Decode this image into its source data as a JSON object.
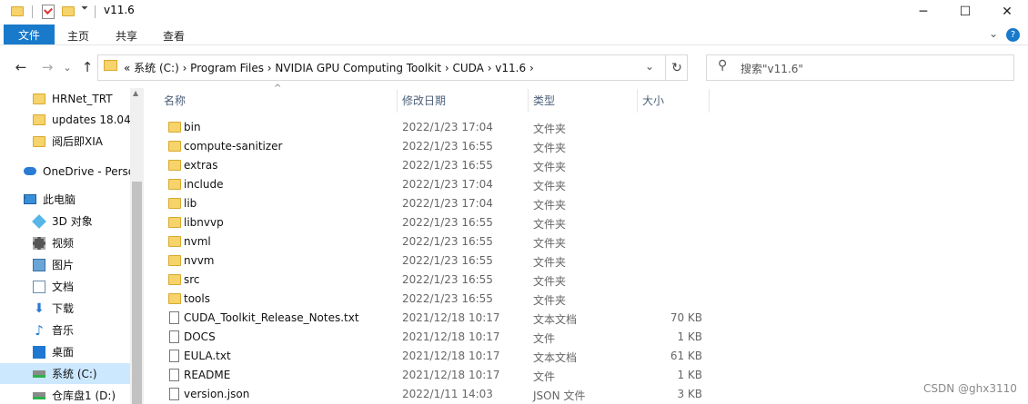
{
  "window": {
    "title": "v11.6",
    "controls": {
      "minimize": "─",
      "maximize": "☐",
      "close": "✕"
    }
  },
  "ribbon": {
    "tabs": [
      "文件",
      "主页",
      "共享",
      "查看"
    ],
    "expand_icon": "⌄",
    "help_icon": "?"
  },
  "navigation": {
    "back": "←",
    "forward": "→",
    "recent": "⌄",
    "up": "↑"
  },
  "address_bar": {
    "text": "«  系统 (C:)  ›  Program Files  ›  NVIDIA GPU Computing Toolkit  ›  CUDA  ›  v11.6  ›",
    "dropdown_icon": "⌄",
    "refresh_icon": "↻"
  },
  "search": {
    "placeholder": "搜索\"v11.6\"",
    "icon": "⚲"
  },
  "nav_pane": {
    "items": [
      {
        "label": "HRNet_TRT",
        "icon": "folder-icon"
      },
      {
        "label": "updates 18.04.",
        "icon": "folder-icon"
      },
      {
        "label": "阅后即XIA",
        "icon": "folder-icon"
      },
      {
        "label": "OneDrive - Perso",
        "icon": "cloud-icon"
      },
      {
        "label": "此电脑",
        "icon": "computer-icon"
      },
      {
        "label": "3D 对象",
        "icon": "cube-icon"
      },
      {
        "label": "视频",
        "icon": "video-icon"
      },
      {
        "label": "图片",
        "icon": "picture-icon"
      },
      {
        "label": "文档",
        "icon": "document-icon"
      },
      {
        "label": "下载",
        "icon": "download-icon"
      },
      {
        "label": "音乐",
        "icon": "music-icon"
      },
      {
        "label": "桌面",
        "icon": "desktop-icon"
      },
      {
        "label": "系统 (C:)",
        "icon": "drive-icon",
        "selected": true
      },
      {
        "label": "仓库盘1 (D:)",
        "icon": "drive-icon"
      }
    ]
  },
  "file_list": {
    "columns": {
      "name": "名称",
      "date": "修改日期",
      "type": "类型",
      "size": "大小"
    },
    "sort_indicator": "^",
    "rows": [
      {
        "name": "bin",
        "date": "2022/1/23 17:04",
        "type": "文件夹",
        "size": "",
        "kind": "folder"
      },
      {
        "name": "compute-sanitizer",
        "date": "2022/1/23 16:55",
        "type": "文件夹",
        "size": "",
        "kind": "folder"
      },
      {
        "name": "extras",
        "date": "2022/1/23 16:55",
        "type": "文件夹",
        "size": "",
        "kind": "folder"
      },
      {
        "name": "include",
        "date": "2022/1/23 17:04",
        "type": "文件夹",
        "size": "",
        "kind": "folder"
      },
      {
        "name": "lib",
        "date": "2022/1/23 17:04",
        "type": "文件夹",
        "size": "",
        "kind": "folder"
      },
      {
        "name": "libnvvp",
        "date": "2022/1/23 16:55",
        "type": "文件夹",
        "size": "",
        "kind": "folder"
      },
      {
        "name": "nvml",
        "date": "2022/1/23 16:55",
        "type": "文件夹",
        "size": "",
        "kind": "folder"
      },
      {
        "name": "nvvm",
        "date": "2022/1/23 16:55",
        "type": "文件夹",
        "size": "",
        "kind": "folder"
      },
      {
        "name": "src",
        "date": "2022/1/23 16:55",
        "type": "文件夹",
        "size": "",
        "kind": "folder"
      },
      {
        "name": "tools",
        "date": "2022/1/23 16:55",
        "type": "文件夹",
        "size": "",
        "kind": "folder"
      },
      {
        "name": "CUDA_Toolkit_Release_Notes.txt",
        "date": "2021/12/18 10:17",
        "type": "文本文档",
        "size": "70 KB",
        "kind": "file"
      },
      {
        "name": "DOCS",
        "date": "2021/12/18 10:17",
        "type": "文件",
        "size": "1 KB",
        "kind": "file"
      },
      {
        "name": "EULA.txt",
        "date": "2021/12/18 10:17",
        "type": "文本文档",
        "size": "61 KB",
        "kind": "file"
      },
      {
        "name": "README",
        "date": "2021/12/18 10:17",
        "type": "文件",
        "size": "1 KB",
        "kind": "file"
      },
      {
        "name": "version.json",
        "date": "2022/1/11 14:03",
        "type": "JSON 文件",
        "size": "3 KB",
        "kind": "file"
      }
    ]
  },
  "watermark": "CSDN @ghx3110",
  "colors": {
    "accent": "#1979ca",
    "selection": "#cce8ff",
    "folder": "#f6d36b"
  }
}
